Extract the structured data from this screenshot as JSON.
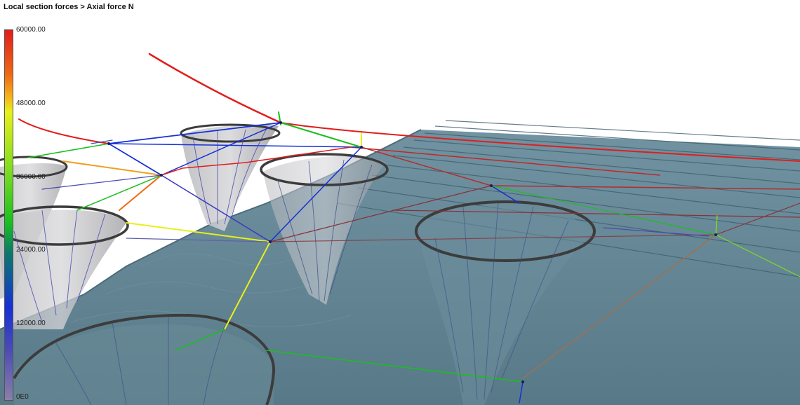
{
  "viewport": {
    "title": "Local section forces > Axial force N"
  },
  "legend": {
    "ticks": [
      "60000.00",
      "48000.00",
      "36000.00",
      "24000.00",
      "12000.00",
      "0E0"
    ]
  },
  "colors": {
    "surface": "#5f8393",
    "surface_dark": "#4c6d7c",
    "shell_gray": "#a9a9ad",
    "rim": "#3c3c3c",
    "force_max": "#e11d1d",
    "force_high": "#f0a020",
    "force_mid": "#e8f01a",
    "force_low": "#18c01e",
    "force_min": "#1531d8"
  }
}
